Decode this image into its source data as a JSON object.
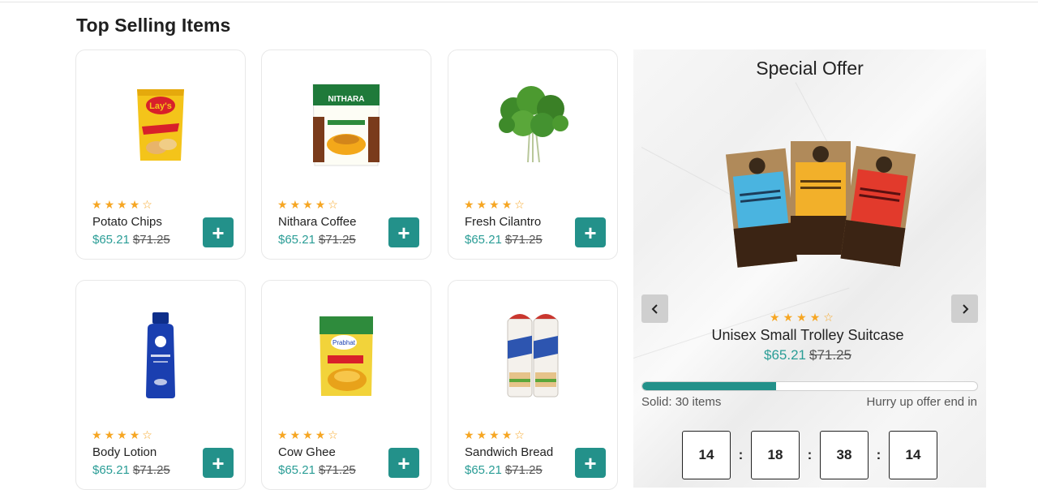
{
  "section": {
    "title": "Top Selling Items"
  },
  "products": [
    {
      "name": "Potato Chips",
      "price": "$65.21",
      "old_price": "$71.25",
      "rating": 4,
      "image": "chips-bag-icon"
    },
    {
      "name": "Nithara Coffee",
      "price": "$65.21",
      "old_price": "$71.25",
      "rating": 4,
      "image": "coffee-pack-icon"
    },
    {
      "name": "Fresh Cilantro",
      "price": "$65.21",
      "old_price": "$71.25",
      "rating": 4,
      "image": "cilantro-icon"
    },
    {
      "name": "Body Lotion",
      "price": "$65.21",
      "old_price": "$71.25",
      "rating": 4,
      "image": "lotion-bottle-icon"
    },
    {
      "name": "Cow Ghee",
      "price": "$65.21",
      "old_price": "$71.25",
      "rating": 4,
      "image": "ghee-pack-icon"
    },
    {
      "name": "Sandwich Bread",
      "price": "$65.21",
      "old_price": "$71.25",
      "rating": 4,
      "image": "bread-loaf-icon"
    }
  ],
  "add_label": "+",
  "offer": {
    "title": "Special Offer",
    "product_name": "Unisex Small Trolley Suitcase",
    "price": "$65.21",
    "old_price": "$71.25",
    "rating": 4,
    "progress_percent": 40,
    "sold_text": "Solid: 30 items",
    "hurry_text": "Hurry up offer end in",
    "timer": [
      "14",
      "18",
      "38",
      "14"
    ],
    "timer_separator": ":",
    "image": "coffee-packs-icon"
  },
  "colors": {
    "accent": "#23918a",
    "price": "#2a9d96",
    "star": "#f6a623"
  }
}
